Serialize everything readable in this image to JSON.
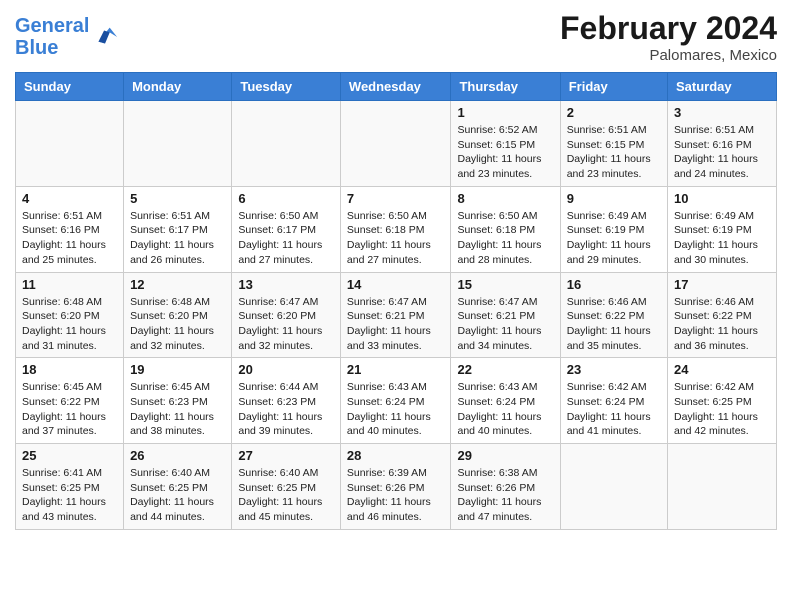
{
  "header": {
    "logo_line1": "General",
    "logo_line2": "Blue",
    "month_year": "February 2024",
    "location": "Palomares, Mexico"
  },
  "days_of_week": [
    "Sunday",
    "Monday",
    "Tuesday",
    "Wednesday",
    "Thursday",
    "Friday",
    "Saturday"
  ],
  "weeks": [
    [
      {
        "day": "",
        "info": ""
      },
      {
        "day": "",
        "info": ""
      },
      {
        "day": "",
        "info": ""
      },
      {
        "day": "",
        "info": ""
      },
      {
        "day": "1",
        "info": "Sunrise: 6:52 AM\nSunset: 6:15 PM\nDaylight: 11 hours and 23 minutes."
      },
      {
        "day": "2",
        "info": "Sunrise: 6:51 AM\nSunset: 6:15 PM\nDaylight: 11 hours and 23 minutes."
      },
      {
        "day": "3",
        "info": "Sunrise: 6:51 AM\nSunset: 6:16 PM\nDaylight: 11 hours and 24 minutes."
      }
    ],
    [
      {
        "day": "4",
        "info": "Sunrise: 6:51 AM\nSunset: 6:16 PM\nDaylight: 11 hours and 25 minutes."
      },
      {
        "day": "5",
        "info": "Sunrise: 6:51 AM\nSunset: 6:17 PM\nDaylight: 11 hours and 26 minutes."
      },
      {
        "day": "6",
        "info": "Sunrise: 6:50 AM\nSunset: 6:17 PM\nDaylight: 11 hours and 27 minutes."
      },
      {
        "day": "7",
        "info": "Sunrise: 6:50 AM\nSunset: 6:18 PM\nDaylight: 11 hours and 27 minutes."
      },
      {
        "day": "8",
        "info": "Sunrise: 6:50 AM\nSunset: 6:18 PM\nDaylight: 11 hours and 28 minutes."
      },
      {
        "day": "9",
        "info": "Sunrise: 6:49 AM\nSunset: 6:19 PM\nDaylight: 11 hours and 29 minutes."
      },
      {
        "day": "10",
        "info": "Sunrise: 6:49 AM\nSunset: 6:19 PM\nDaylight: 11 hours and 30 minutes."
      }
    ],
    [
      {
        "day": "11",
        "info": "Sunrise: 6:48 AM\nSunset: 6:20 PM\nDaylight: 11 hours and 31 minutes."
      },
      {
        "day": "12",
        "info": "Sunrise: 6:48 AM\nSunset: 6:20 PM\nDaylight: 11 hours and 32 minutes."
      },
      {
        "day": "13",
        "info": "Sunrise: 6:47 AM\nSunset: 6:20 PM\nDaylight: 11 hours and 32 minutes."
      },
      {
        "day": "14",
        "info": "Sunrise: 6:47 AM\nSunset: 6:21 PM\nDaylight: 11 hours and 33 minutes."
      },
      {
        "day": "15",
        "info": "Sunrise: 6:47 AM\nSunset: 6:21 PM\nDaylight: 11 hours and 34 minutes."
      },
      {
        "day": "16",
        "info": "Sunrise: 6:46 AM\nSunset: 6:22 PM\nDaylight: 11 hours and 35 minutes."
      },
      {
        "day": "17",
        "info": "Sunrise: 6:46 AM\nSunset: 6:22 PM\nDaylight: 11 hours and 36 minutes."
      }
    ],
    [
      {
        "day": "18",
        "info": "Sunrise: 6:45 AM\nSunset: 6:22 PM\nDaylight: 11 hours and 37 minutes."
      },
      {
        "day": "19",
        "info": "Sunrise: 6:45 AM\nSunset: 6:23 PM\nDaylight: 11 hours and 38 minutes."
      },
      {
        "day": "20",
        "info": "Sunrise: 6:44 AM\nSunset: 6:23 PM\nDaylight: 11 hours and 39 minutes."
      },
      {
        "day": "21",
        "info": "Sunrise: 6:43 AM\nSunset: 6:24 PM\nDaylight: 11 hours and 40 minutes."
      },
      {
        "day": "22",
        "info": "Sunrise: 6:43 AM\nSunset: 6:24 PM\nDaylight: 11 hours and 40 minutes."
      },
      {
        "day": "23",
        "info": "Sunrise: 6:42 AM\nSunset: 6:24 PM\nDaylight: 11 hours and 41 minutes."
      },
      {
        "day": "24",
        "info": "Sunrise: 6:42 AM\nSunset: 6:25 PM\nDaylight: 11 hours and 42 minutes."
      }
    ],
    [
      {
        "day": "25",
        "info": "Sunrise: 6:41 AM\nSunset: 6:25 PM\nDaylight: 11 hours and 43 minutes."
      },
      {
        "day": "26",
        "info": "Sunrise: 6:40 AM\nSunset: 6:25 PM\nDaylight: 11 hours and 44 minutes."
      },
      {
        "day": "27",
        "info": "Sunrise: 6:40 AM\nSunset: 6:25 PM\nDaylight: 11 hours and 45 minutes."
      },
      {
        "day": "28",
        "info": "Sunrise: 6:39 AM\nSunset: 6:26 PM\nDaylight: 11 hours and 46 minutes."
      },
      {
        "day": "29",
        "info": "Sunrise: 6:38 AM\nSunset: 6:26 PM\nDaylight: 11 hours and 47 minutes."
      },
      {
        "day": "",
        "info": ""
      },
      {
        "day": "",
        "info": ""
      }
    ]
  ]
}
